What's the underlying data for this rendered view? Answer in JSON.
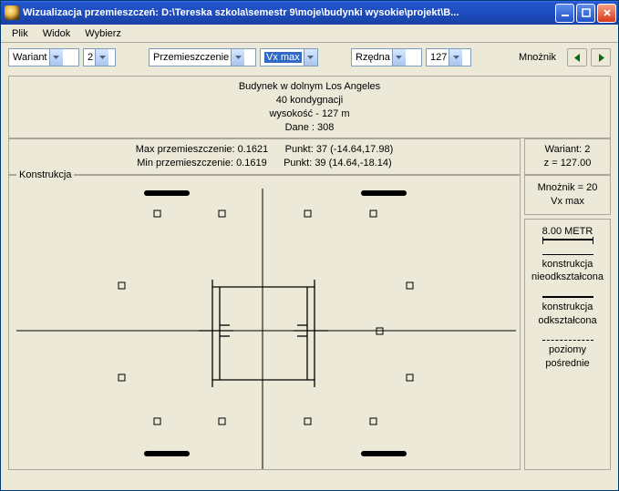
{
  "window": {
    "title": "Wizualizacja przemieszczeń: D:\\Tereska szkola\\semestr 9\\moje\\budynki wysokie\\projekt\\B..."
  },
  "menu": {
    "file": "Plik",
    "view": "Widok",
    "select": "Wybierz"
  },
  "toolbar": {
    "wariant_label": "Wariant",
    "wariant_value": "2",
    "przemieszczenie_label": "Przemieszczenie",
    "przemieszczenie_value": "Vx max",
    "rzedna_label": "Rzędna",
    "rzedna_value": "127",
    "mnoznik_label": "Mnożnik"
  },
  "header": {
    "line1": "Budynek w dolnym Los Angeles",
    "line2": "40 kondygnacji",
    "line3": "wysokość - 127 m",
    "line4": "Dane :   308"
  },
  "stats": {
    "max_label": "Max przemieszczenie: 0.1621",
    "max_point": "Punkt: 37 (-14.64,17.98)",
    "min_label": "Min przemieszczenie: 0.1619",
    "min_point": "Punkt: 39 (14.64,-18.14)"
  },
  "right_info": {
    "line1": "Wariant: 2",
    "line2": "z = 127.00"
  },
  "group_label": "Konstrukcja",
  "side": {
    "box1_line1": "Mnożnik = 20",
    "box1_line2": "Vx max",
    "scale": "8.00  METR",
    "legend1a": "konstrukcja",
    "legend1b": "nieodkształcona",
    "legend2a": "konstrukcja",
    "legend2b": "odkształcona",
    "legend3a": "poziomy",
    "legend3b": "pośrednie"
  }
}
